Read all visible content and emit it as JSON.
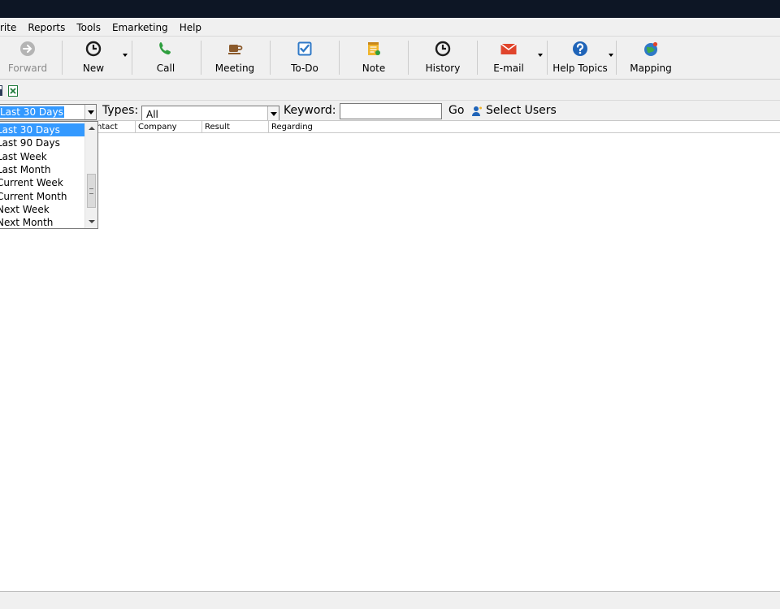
{
  "menu": [
    "rite",
    "Reports",
    "Tools",
    "Emarketing",
    "Help"
  ],
  "toolbar": {
    "forward": "Forward",
    "new": "New",
    "call": "Call",
    "meeting": "Meeting",
    "todo": "To-Do",
    "note": "Note",
    "history": "History",
    "email": "E-mail",
    "help_topics": "Help Topics",
    "mapping": "Mapping"
  },
  "filters": {
    "date_range_value": "Last 30 Days",
    "types_label": "Types:",
    "types_value": "All",
    "keyword_label": "Keyword:",
    "keyword_value": "",
    "go_label": "Go",
    "select_users_label": "Select Users"
  },
  "columns": [
    "ntact",
    "Company",
    "Result",
    "Regarding"
  ],
  "dropdown_options": [
    "Last 30 Days",
    "Last 90 Days",
    "Last Week",
    "Last Month",
    "Current Week",
    "Current Month",
    "Next Week",
    "Next Month"
  ],
  "dropdown_selected": "Last 30 Days",
  "colors": {
    "titlebar": "#0d1625",
    "selection": "#3399ff",
    "call_green": "#2e9e3e",
    "todo_blue": "#2f79c7",
    "email_red": "#e0442b",
    "help_blue": "#1f64b8",
    "note_yellow": "#f0b52c",
    "meeting_brown": "#8b5a2b"
  },
  "icons": {
    "forward": "forward-arrow-icon",
    "new": "new-activity-clock-icon",
    "call": "phone-icon",
    "meeting": "coffee-cup-icon",
    "todo": "checkbox-icon",
    "note": "note-icon",
    "history": "history-clock-icon",
    "email": "envelope-icon",
    "help": "question-mark-icon",
    "mapping": "globe-icon",
    "select_users": "user-icon"
  }
}
